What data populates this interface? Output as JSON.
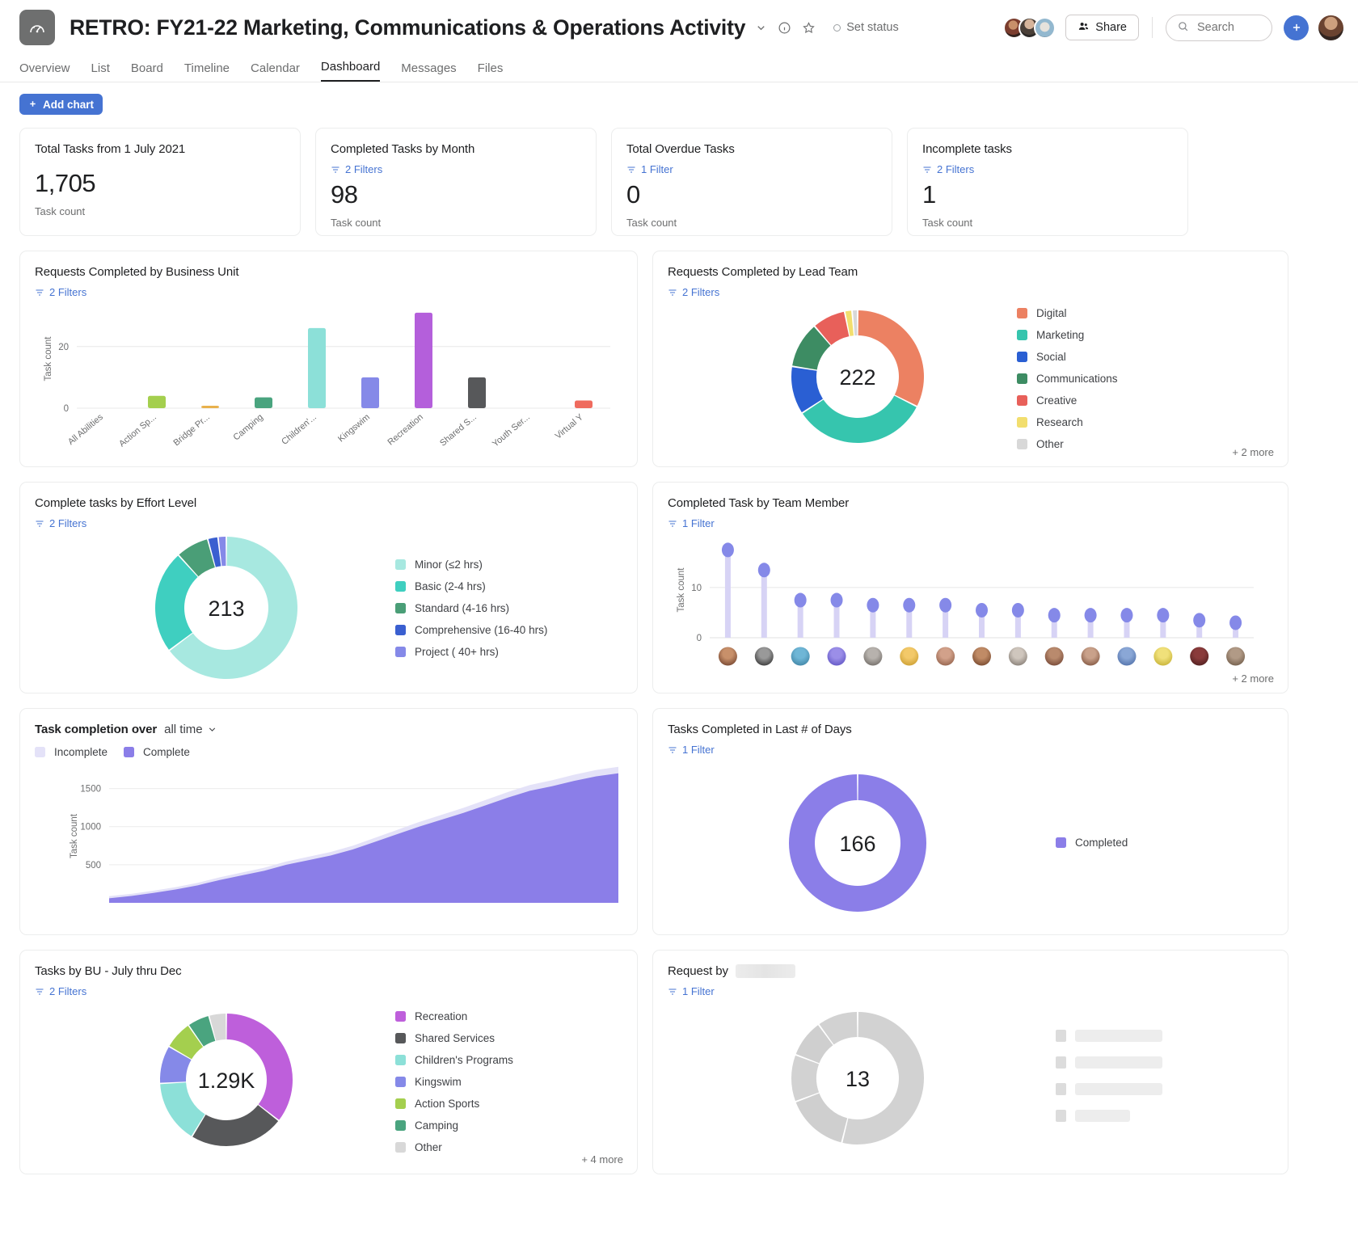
{
  "header": {
    "project_title": "RETRO: FY21-22 Marketing, Communications & Operations Activity",
    "set_status": "Set status",
    "share_label": "Share",
    "search_placeholder": "Search",
    "plus_label": "+"
  },
  "tabs": [
    {
      "label": "Overview",
      "active": false
    },
    {
      "label": "List",
      "active": false
    },
    {
      "label": "Board",
      "active": false
    },
    {
      "label": "Timeline",
      "active": false
    },
    {
      "label": "Calendar",
      "active": false
    },
    {
      "label": "Dashboard",
      "active": true
    },
    {
      "label": "Messages",
      "active": false
    },
    {
      "label": "Files",
      "active": false
    }
  ],
  "toolbar": {
    "add_chart_label": "Add chart"
  },
  "metrics": [
    {
      "title": "Total Tasks from 1 July 2021",
      "value": "1,705",
      "unit": "Task count",
      "filters": ""
    },
    {
      "title": "Completed Tasks by Month",
      "value": "98",
      "unit": "Task count",
      "filters": "2 Filters"
    },
    {
      "title": "Total Overdue Tasks",
      "value": "0",
      "unit": "Task count",
      "filters": "1 Filter"
    },
    {
      "title": "Incomplete tasks",
      "value": "1",
      "unit": "Task count",
      "filters": "2 Filters"
    }
  ],
  "cards": {
    "business_unit": {
      "title": "Requests Completed by Business Unit",
      "filters": "2 Filters"
    },
    "lead_team": {
      "title": "Requests Completed by Lead Team",
      "filters": "2 Filters",
      "more": "+ 2 more"
    },
    "effort_level": {
      "title": "Complete tasks by Effort Level",
      "filters": "2 Filters"
    },
    "team_member": {
      "title": "Completed Task by Team Member",
      "filters": "1 Filter",
      "more": "+ 2 more"
    },
    "completion_over": {
      "title": "Task completion over",
      "range": "all time"
    },
    "last_days": {
      "title": "Tasks Completed in Last # of Days",
      "filters": "1 Filter"
    },
    "bu_july_dec": {
      "title": "Tasks by BU - July thru Dec",
      "filters": "2 Filters",
      "more": "+ 4 more"
    },
    "request_by": {
      "title": "Request by",
      "filters": "1 Filter",
      "redacted": true
    }
  },
  "chart_data": [
    {
      "id": "business_unit",
      "type": "bar",
      "title": "Requests Completed by Business Unit",
      "xlabel": "",
      "ylabel": "Task count",
      "ylim": [
        0,
        32
      ],
      "yticks": [
        0,
        20
      ],
      "grid": true,
      "categories": [
        "All Abilities",
        "Action Sp...",
        "Bridge Pr...",
        "Camping",
        "Children'...",
        "Kingswim",
        "Recreation",
        "Shared S...",
        "Youth Ser...",
        "Virtual Y"
      ],
      "values": [
        0,
        4,
        0.8,
        3.5,
        26,
        10,
        31,
        10,
        0,
        2.5
      ],
      "colors": [
        "#8ed16a",
        "#a4cf4e",
        "#e8b14c",
        "#4aa47f",
        "#8ce0d8",
        "#8589e8",
        "#b45fdb",
        "#57585a",
        "#f2a3a3",
        "#ef6b5e"
      ]
    },
    {
      "id": "lead_team",
      "type": "pie",
      "title": "Requests Completed by Lead Team",
      "center_value": "222",
      "labels": [
        "Digital",
        "Marketing",
        "Social",
        "Communications",
        "Creative",
        "Research",
        "Other"
      ],
      "values": [
        72,
        74,
        26,
        25,
        18,
        4,
        3
      ],
      "colors": [
        "#ec8162",
        "#36c5ae",
        "#2a5fd3",
        "#3d8c63",
        "#e8605a",
        "#f2de6e",
        "#d8d8d8"
      ],
      "legend": "right"
    },
    {
      "id": "effort_level",
      "type": "pie",
      "title": "Complete tasks by Effort Level",
      "center_value": "213",
      "labels": [
        "Minor (≤2 hrs)",
        "Basic (2-4 hrs)",
        "Standard (4-16 hrs)",
        "Comprehensive (16-40 hrs)",
        "Project ( 40+ hrs)"
      ],
      "values": [
        138,
        50,
        16,
        5,
        4
      ],
      "colors": [
        "#a7e8e0",
        "#3fcfc0",
        "#4a9e77",
        "#3a5fd0",
        "#8589e8"
      ],
      "legend": "right"
    },
    {
      "id": "team_member",
      "type": "scatter",
      "title": "Completed Task by Team Member",
      "ylabel": "Task count",
      "ylim": [
        0,
        19
      ],
      "yticks": [
        0,
        10
      ],
      "values": [
        17,
        13,
        7,
        7,
        6,
        6,
        6,
        5,
        5,
        4,
        4,
        4,
        4,
        3,
        2.5
      ],
      "color": "#8589e8",
      "xlabel": "team member avatars"
    },
    {
      "id": "completion_over",
      "type": "area",
      "title": "Task completion over all time",
      "ylabel": "Task count",
      "ylim": [
        0,
        1750
      ],
      "yticks": [
        500,
        1000,
        1500
      ],
      "series": [
        {
          "name": "Incomplete",
          "color": "#e4e2f8"
        },
        {
          "name": "Complete",
          "color": "#8b7ee8"
        }
      ],
      "values": [
        60,
        90,
        130,
        175,
        230,
        300,
        360,
        420,
        500,
        560,
        620,
        700,
        800,
        900,
        1000,
        1090,
        1180,
        1280,
        1380,
        1470,
        1530,
        1600,
        1660,
        1700
      ]
    },
    {
      "id": "last_days",
      "type": "pie",
      "title": "Tasks Completed in Last # of Days",
      "center_value": "166",
      "labels": [
        "Completed"
      ],
      "values": [
        166
      ],
      "colors": [
        "#8b7ee8"
      ],
      "legend": "right"
    },
    {
      "id": "bu_july_dec",
      "type": "pie",
      "title": "Tasks by BU - July thru Dec",
      "center_value": "1.29K",
      "labels": [
        "Recreation",
        "Shared Services",
        "Children's Programs",
        "Kingswim",
        "Action Sports",
        "Camping",
        "Other"
      ],
      "values": [
        460,
        300,
        200,
        120,
        90,
        70,
        55
      ],
      "colors": [
        "#be5fdb",
        "#57585a",
        "#8ce0d8",
        "#8589e8",
        "#a4cf4e",
        "#4aa47f",
        "#d8d8d8"
      ],
      "legend": "right"
    },
    {
      "id": "request_by",
      "type": "pie",
      "title": "Request by",
      "center_value": "13",
      "labels": [
        "",
        "",
        "",
        "",
        ""
      ],
      "values": [
        7,
        2,
        1.5,
        1.2,
        1.3
      ],
      "colors": [
        "#d2d2d2",
        "#cfcfcf",
        "#d2d2d2",
        "#cfcfcf",
        "#d2d2d2"
      ],
      "legend": "right"
    }
  ]
}
